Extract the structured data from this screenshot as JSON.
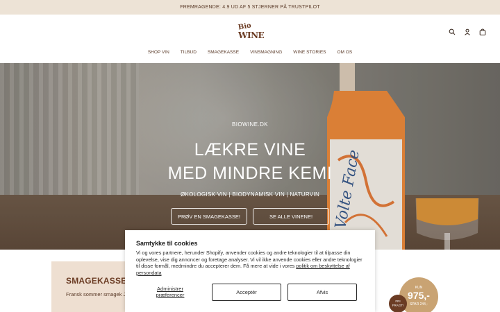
{
  "announcement": "FREMRAGENDE: 4.9 UD AF 5 STJERNER PÅ TRUSTPILOT",
  "logo": {
    "line1": "Bio",
    "line2": "WINE"
  },
  "header_icons": [
    "search-icon",
    "account-icon",
    "bag-icon"
  ],
  "nav": [
    "SHOP VIN",
    "TILBUD",
    "SMAGEKASSE",
    "VINSMAGNING",
    "WINE STORIES",
    "OM OS"
  ],
  "hero": {
    "kicker": "BIOWINE.DK",
    "title_line1": "LÆKRE VINE",
    "title_line2": "MED MINDRE KEMI",
    "subtitle": "ØKOLOGISK VIN | BIODYNAMISK VIN | NATURVIN",
    "button_primary": "PRØV EN SMAGEKASSE!",
    "button_secondary": "SE ALLE VINENE!",
    "bottle_label": "Volte Face"
  },
  "promo": {
    "title": "SMAGEKASSE",
    "text": "Fransk sommer smagek Jura og Rhône!"
  },
  "price_badge": {
    "label": "KUN",
    "price": "975,-",
    "save": "SPAR 244,-"
  },
  "shipping_badge": {
    "line1": "FRI",
    "line2": "FRAGT!"
  },
  "cookie": {
    "title": "Samtykke til cookies",
    "body": "Vi og vores partnere, herunder Shopify, anvender cookies og andre teknologier til at tilpasse din oplevelse, vise dig annoncer og foretage analyser. Vi vil ikke anvende cookies eller andre teknologier til disse formål, medmindre du accepterer dem. Få mere at vide i vores ",
    "link": "politik om beskyttelse af persondata",
    "manage_line1": "Administrer",
    "manage_line2": "præferencer",
    "accept": "Acceptér",
    "reject": "Afvis"
  },
  "colors": {
    "brand": "#6b3c24",
    "announce_bg": "#ede3d6",
    "promo_bg": "#eedfd1",
    "badge": "#c9a373"
  }
}
